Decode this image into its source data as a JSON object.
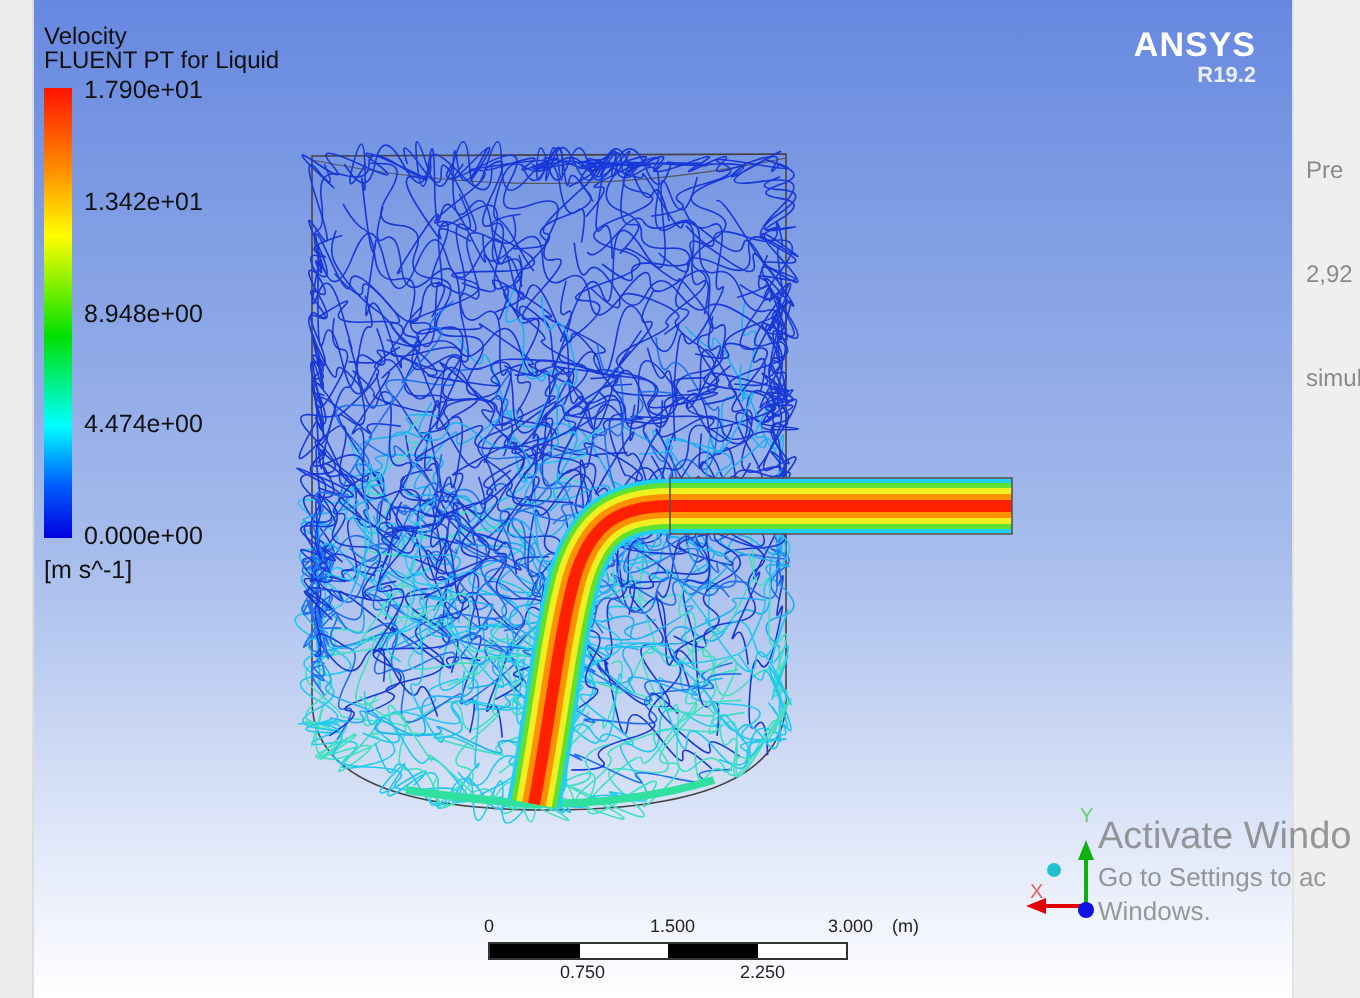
{
  "legend": {
    "title": "Velocity",
    "subtitle": "FLUENT PT for Liquid",
    "ticks": [
      "1.790e+01",
      "1.342e+01",
      "8.948e+00",
      "4.474e+00",
      "0.000e+00"
    ],
    "unit": "[m s^-1]"
  },
  "logo": {
    "name": "ANSYS",
    "version": "R19.2"
  },
  "scale_bar": {
    "top_labels": [
      "0",
      "1.500",
      "3.000"
    ],
    "unit": "(m)",
    "bottom_labels": [
      "0.750",
      "2.250"
    ]
  },
  "triad": {
    "labels": [
      "Y",
      "X"
    ]
  },
  "side_panel": {
    "texts": [
      "Pre",
      "2,92",
      "simul"
    ]
  },
  "os_notice": {
    "title": "Activate Windo",
    "line_1": "Go to Settings to ac",
    "line_2": "Windows."
  }
}
